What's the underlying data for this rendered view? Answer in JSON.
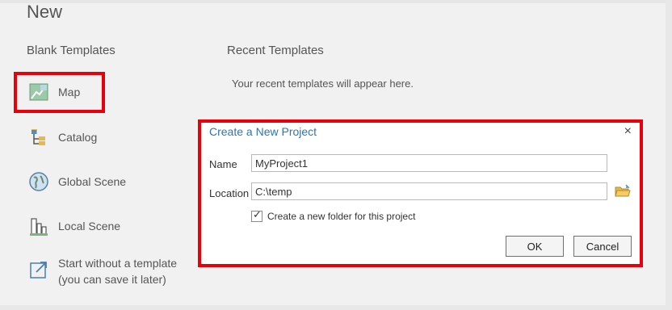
{
  "page": {
    "title": "New"
  },
  "blank": {
    "heading": "Blank Templates",
    "items": [
      {
        "label": "Map",
        "icon": "map-icon"
      },
      {
        "label": "Catalog",
        "icon": "catalog-icon"
      },
      {
        "label": "Global Scene",
        "icon": "globe-icon"
      },
      {
        "label": "Local Scene",
        "icon": "buildings-icon"
      },
      {
        "label_line1": "Start without a template",
        "label_line2": "(you can save it later)",
        "icon": "open-arrow-icon"
      }
    ]
  },
  "recent": {
    "heading": "Recent Templates",
    "message": "Your recent templates will appear here."
  },
  "dialog": {
    "title": "Create a New Project",
    "close_glyph": "×",
    "name_label": "Name",
    "name_value": "MyProject1",
    "location_label": "Location",
    "location_value": "C:\\temp",
    "create_folder_label": "Create a new folder for this project",
    "create_folder_checked": true,
    "ok_label": "OK",
    "cancel_label": "Cancel"
  },
  "colors": {
    "highlight": "#e8000b",
    "dialog_title": "#2f76b3"
  }
}
